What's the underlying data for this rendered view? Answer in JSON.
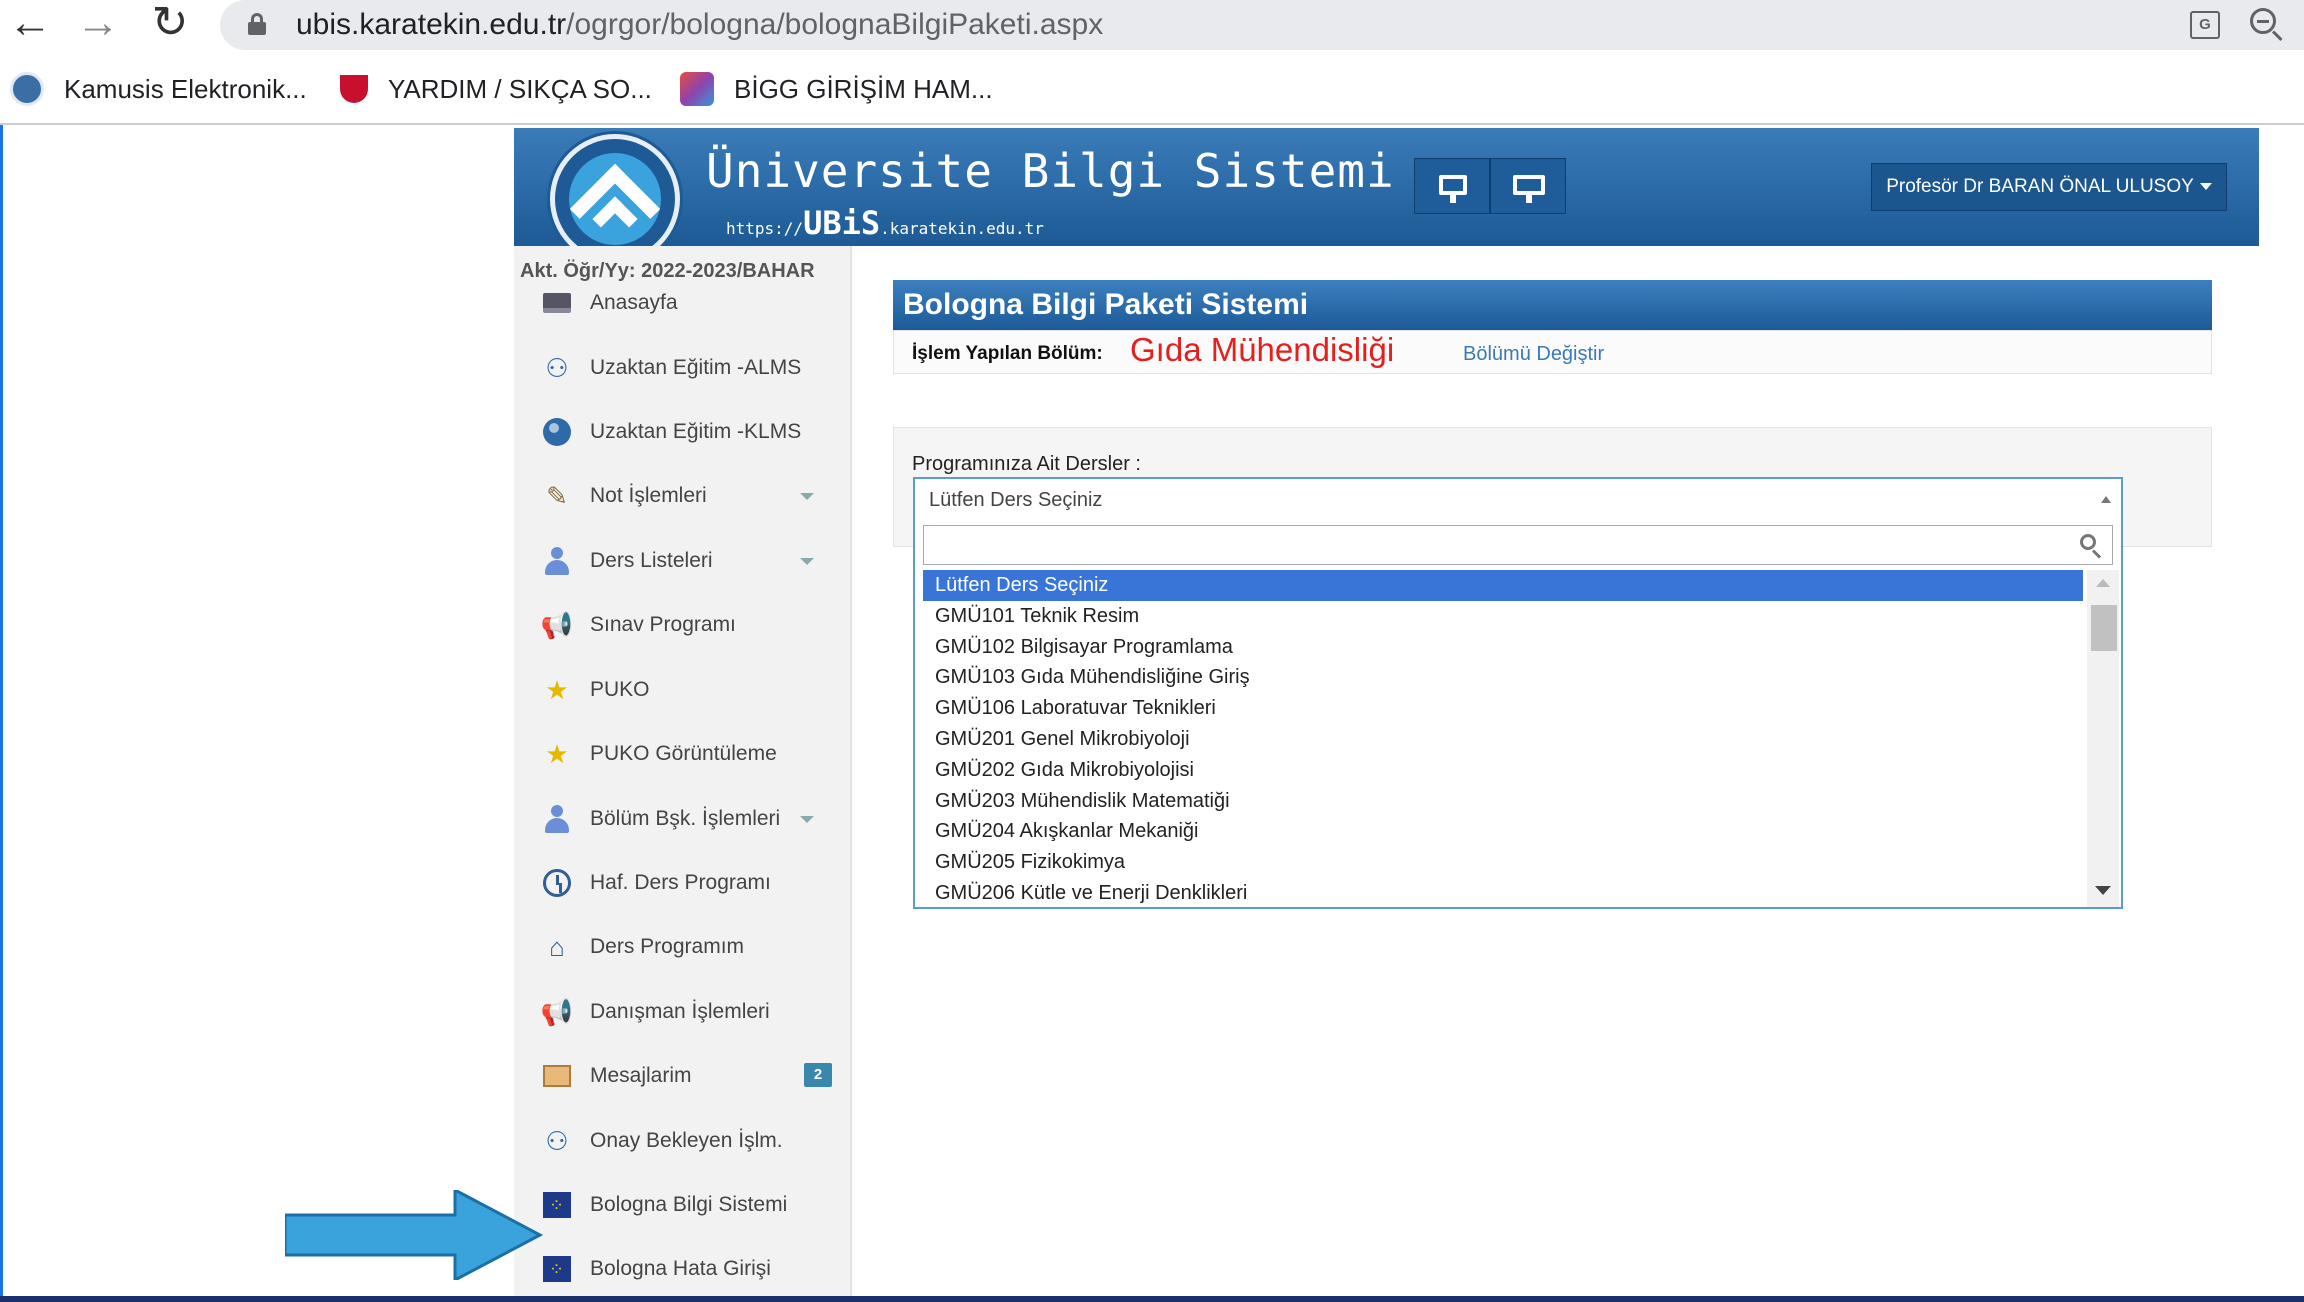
{
  "browser": {
    "url_host": "ubis.karatekin.edu.tr",
    "url_path": "/ogrgor/bologna/bolognaBilgiPaketi.aspx",
    "bookmarks": [
      {
        "label": "Kamusis Elektronik...",
        "icon": "kamusis-icon",
        "color": "#3b6ea5"
      },
      {
        "label": "YARDIM / SIKÇA SO...",
        "icon": "tubitak-icon",
        "color": "#c8102e"
      },
      {
        "label": "BİGG GİRİŞİM HAM...",
        "icon": "bigg-icon",
        "color": "#8e44ad"
      }
    ]
  },
  "header": {
    "title": "Üniversite Bilgi Sistemi",
    "url_prefix": "https://",
    "url_brand": "UBiS",
    "url_suffix": ".karatekin.edu.tr",
    "user": "Profesör Dr BARAN ÖNAL ULUSOY"
  },
  "sidebar": {
    "term": "Akt. Öğr/Yy: 2022-2023/BAHAR",
    "items": [
      {
        "label": "Anasayfa",
        "icon": "laptop-icon"
      },
      {
        "label": "Uzaktan Eğitim -ALMS",
        "icon": "users-icon"
      },
      {
        "label": "Uzaktan Eğitim -KLMS",
        "icon": "globe-icon"
      },
      {
        "label": "Not İşlemleri",
        "icon": "edit-icon",
        "dropdown": true
      },
      {
        "label": "Ders Listeleri",
        "icon": "person-icon",
        "dropdown": true
      },
      {
        "label": "Sınav Programı",
        "icon": "megaphone-icon"
      },
      {
        "label": "PUKO",
        "icon": "star-icon"
      },
      {
        "label": "PUKO Görüntüleme",
        "icon": "star-icon"
      },
      {
        "label": "Bölüm Bşk. İşlemleri",
        "icon": "person-icon",
        "dropdown": true
      },
      {
        "label": "Haf. Ders Programı",
        "icon": "clock-icon"
      },
      {
        "label": "Ders Programım",
        "icon": "home-icon"
      },
      {
        "label": "Danışman İşlemleri",
        "icon": "megaphone-icon"
      },
      {
        "label": "Mesajlarim",
        "icon": "mail-icon",
        "badge": "2"
      },
      {
        "label": "Onay Bekleyen İşlm.",
        "icon": "users-icon"
      },
      {
        "label": "Bologna Bilgi Sistemi",
        "icon": "eu-flag-icon"
      },
      {
        "label": "Bologna Hata Girişi",
        "icon": "eu-flag-icon"
      }
    ]
  },
  "main": {
    "panel_title": "Bologna Bilgi Paketi Sistemi",
    "dept_label": "İşlem Yapılan Bölüm:",
    "dept_name": "Gıda Mühendisliği",
    "dept_change": "Bölümü Değiştir",
    "courses_label": "Programınıza Ait Dersler :",
    "select_value": "Lütfen Ders Seçiniz",
    "search_value": "",
    "options": [
      "Lütfen Ders Seçiniz",
      "GMÜ101 Teknik Resim",
      "GMÜ102 Bilgisayar Programlama",
      "GMÜ103 Gıda Mühendisliğine Giriş",
      "GMÜ106 Laboratuvar Teknikleri",
      "GMÜ201 Genel Mikrobiyoloji",
      "GMÜ202 Gıda Mikrobiyolojisi",
      "GMÜ203 Mühendislik Matematiği",
      "GMÜ204 Akışkanlar Mekaniği",
      "GMÜ205 Fizikokimya",
      "GMÜ206 Kütle ve Enerji Denklikleri"
    ],
    "selected_index": 0
  },
  "colors": {
    "header_blue": "#1d5a96",
    "dept_red": "#e61e1e",
    "selected_option": "#3875d7",
    "arrow": "#3aa3dc"
  }
}
